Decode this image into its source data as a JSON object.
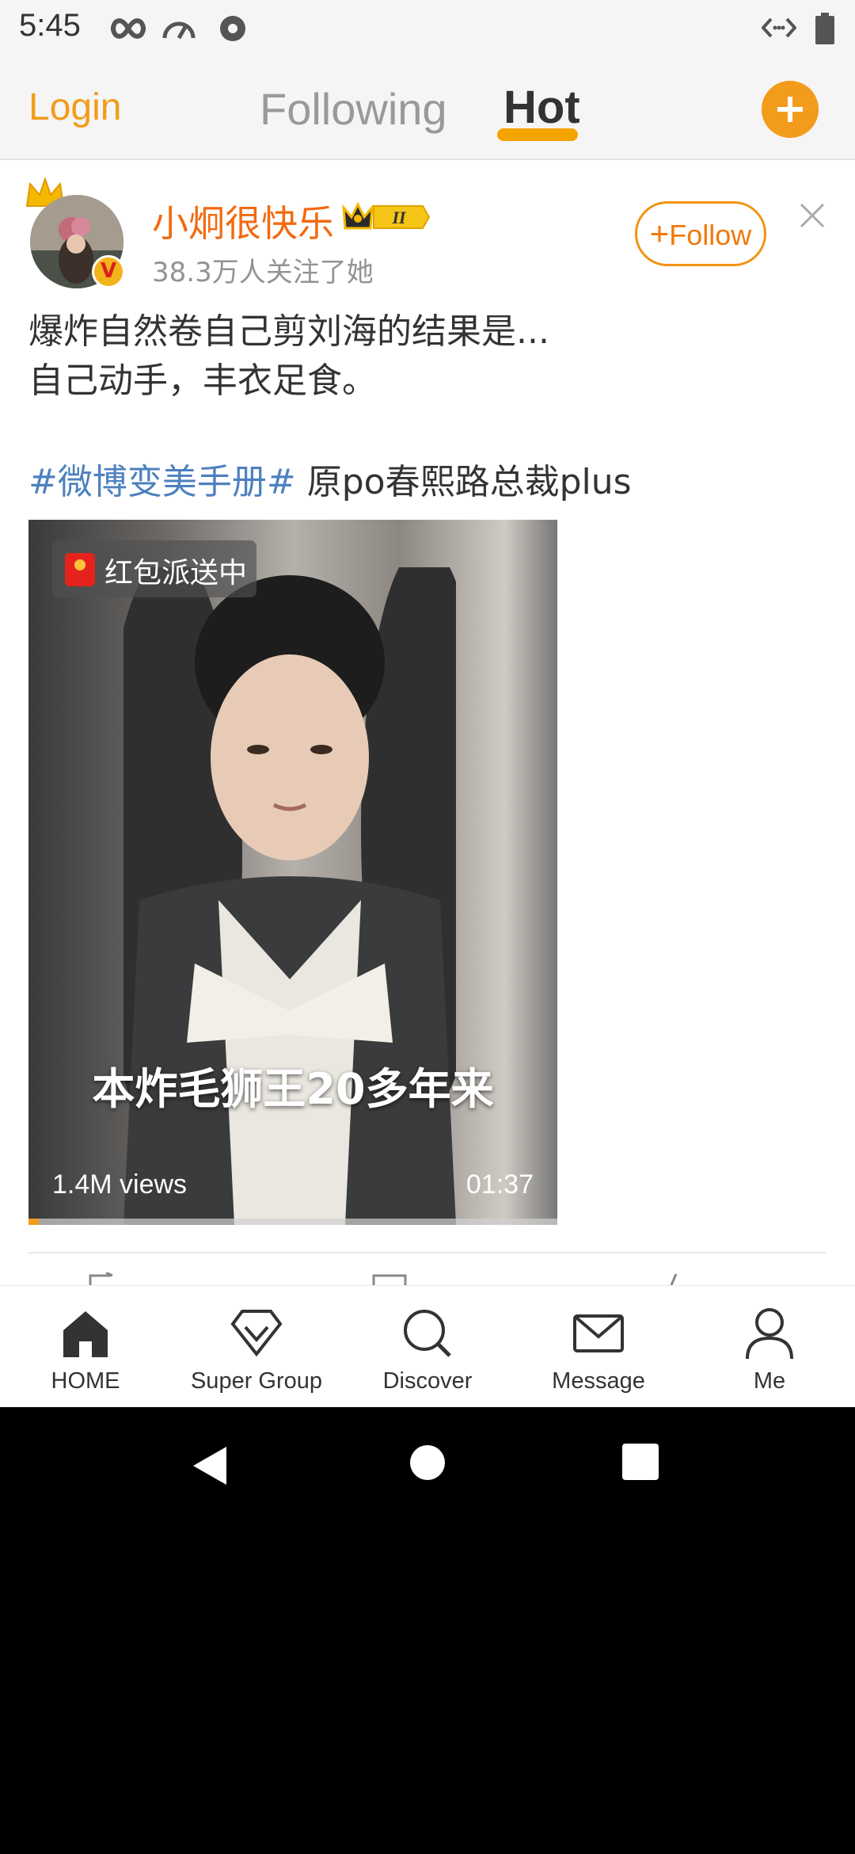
{
  "status_bar": {
    "time": "5:45",
    "left_icons": [
      "infinity-icon",
      "speedometer-icon",
      "notification-badge-icon"
    ],
    "right_icons": [
      "data-arrows-icon",
      "battery-icon"
    ]
  },
  "top_nav": {
    "login": "Login",
    "tabs": [
      {
        "label": "Following",
        "active": false
      },
      {
        "label": "Hot",
        "active": true
      }
    ],
    "compose_icon": "plus-circle-icon",
    "accent_color": "#f39c1b"
  },
  "post": {
    "author": {
      "name": "小炯很快乐",
      "followers": "38.3万人关注了她",
      "verified_mark": "V",
      "vip_level": "II"
    },
    "follow_button": "Follow",
    "follow_plus": "+",
    "text_lines": [
      "爆炸自然卷自己剪刘海的结果是...",
      "自己动手，丰衣足食。"
    ],
    "hashtag": "#微博变美手册#",
    "tag_text": " 原po春熙路总裁plus",
    "video": {
      "badge": "红包派送中",
      "caption": "本炸毛狮王20多年来",
      "views": "1.4M views",
      "duration": "01:37",
      "progress": 0.02
    }
  },
  "tab_bar": {
    "items": [
      {
        "label": "HOME",
        "icon": "home-icon"
      },
      {
        "label": "Super Group",
        "icon": "diamond-icon"
      },
      {
        "label": "Discover",
        "icon": "search-icon"
      },
      {
        "label": "Message",
        "icon": "envelope-icon"
      },
      {
        "label": "Me",
        "icon": "person-icon"
      }
    ]
  },
  "system_nav": [
    "back-icon",
    "home-circle-icon",
    "recents-icon"
  ]
}
